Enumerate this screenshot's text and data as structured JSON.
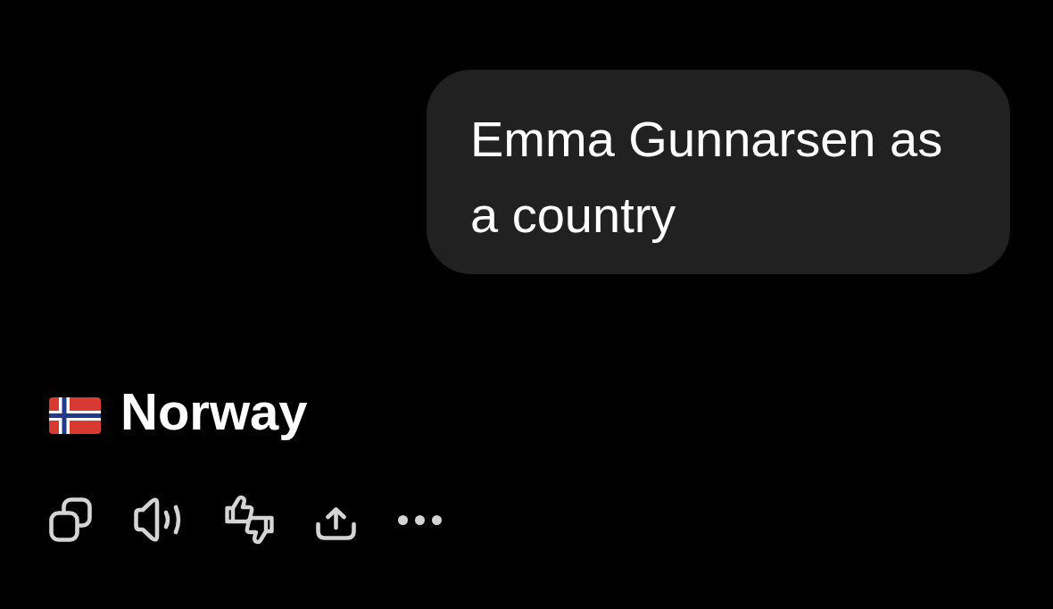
{
  "conversation": {
    "user_message": {
      "text": "Emma Gunnarsen as a country"
    },
    "response": {
      "heading": "Norway"
    },
    "actions": [
      {
        "kind": "copy"
      },
      {
        "kind": "speaker"
      },
      {
        "kind": "thumbs"
      },
      {
        "kind": "share"
      },
      {
        "kind": "more"
      }
    ]
  }
}
